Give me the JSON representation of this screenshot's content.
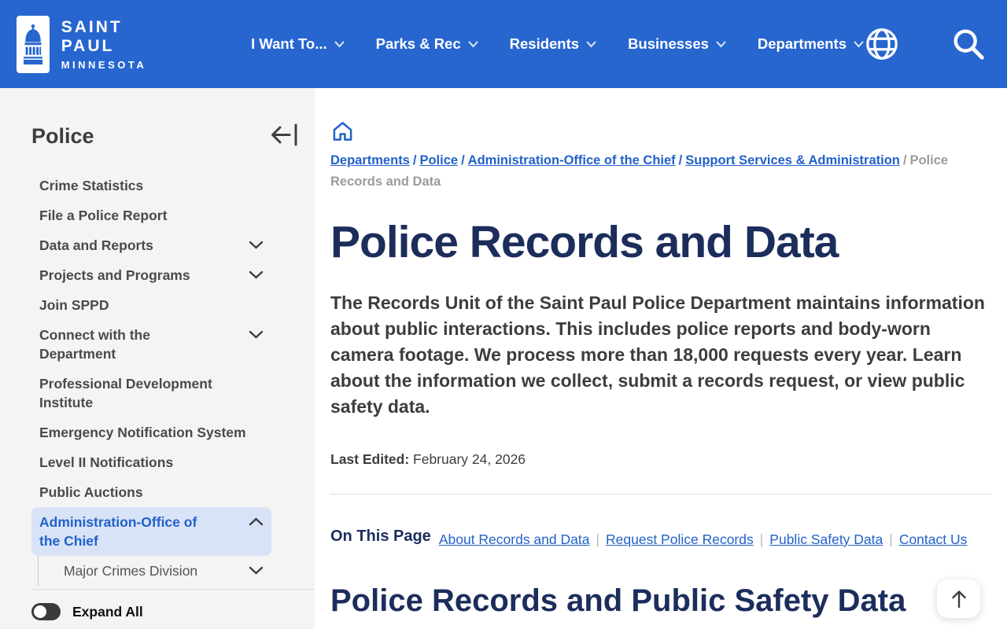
{
  "header": {
    "brand": {
      "line1": "SAINT PAUL",
      "line2": "MINNESOTA"
    },
    "nav": [
      {
        "label": "I Want To..."
      },
      {
        "label": "Parks & Rec"
      },
      {
        "label": "Residents"
      },
      {
        "label": "Businesses"
      },
      {
        "label": "Departments"
      }
    ]
  },
  "sidebar": {
    "title": "Police",
    "items": [
      {
        "label": "Crime Statistics"
      },
      {
        "label": "File a Police Report"
      },
      {
        "label": "Data and Reports"
      },
      {
        "label": "Projects and Programs"
      },
      {
        "label": "Join SPPD"
      },
      {
        "label": "Connect with the Department"
      },
      {
        "label": "Professional Development Institute"
      },
      {
        "label": "Emergency Notification System"
      },
      {
        "label": "Level II Notifications"
      },
      {
        "label": "Public Auctions"
      },
      {
        "label": "Administration-Office of the Chief"
      },
      {
        "label": "Major Crimes Division"
      }
    ],
    "expand_all_label": "Expand All"
  },
  "breadcrumb": {
    "separator": "/",
    "links": [
      {
        "label": "Departments"
      },
      {
        "label": "Police"
      },
      {
        "label": "Administration-Office of the Chief"
      },
      {
        "label": "Support Services & Administration"
      }
    ],
    "current": "Police Records and Data"
  },
  "main": {
    "title": "Police Records and Data",
    "intro": "The Records Unit of the Saint Paul Police Department maintains information about public interactions. This includes police reports and body-worn camera footage. We process more than 18,000 requests every year. Learn about the information we collect, submit a records request, or view public safety data.",
    "last_edited_label": "Last Edited:",
    "last_edited_value": "February 24, 2026",
    "on_this_page": {
      "label": "On This Page",
      "separator": "|",
      "links": [
        {
          "label": "About Records and Data"
        },
        {
          "label": "Request Police Records"
        },
        {
          "label": "Public Safety Data"
        },
        {
          "label": "Contact Us"
        }
      ]
    },
    "section_title": "Police Records and Public Safety Data"
  },
  "colors": {
    "header_blue": "#2766cf",
    "link_blue": "#2262c9",
    "heading_navy": "#1c2d5c",
    "active_item_bg": "#d9e3f7",
    "sidebar_bg": "#f5f4f2"
  }
}
